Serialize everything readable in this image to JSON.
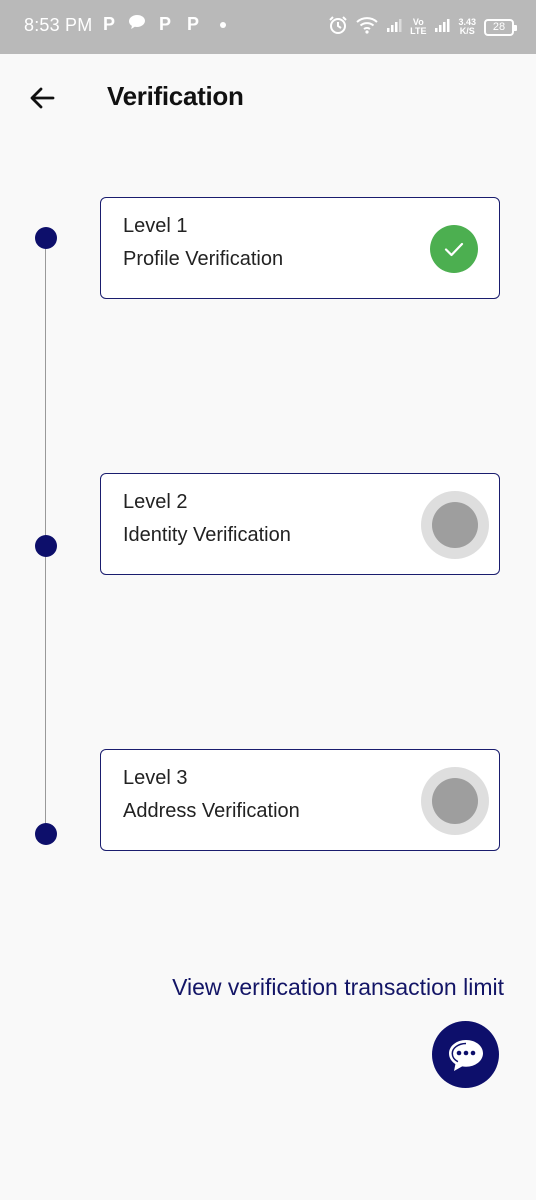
{
  "status_bar": {
    "time": "8:53 PM",
    "notification_icons": [
      "P",
      "P",
      "P"
    ],
    "vol_lte_top": "Vo",
    "vol_lte_bottom": "LTE",
    "speed_value": "3.43",
    "speed_unit": "K/S",
    "battery": "28",
    "icons": [
      "alarm-icon",
      "wifi-icon",
      "signal-icon",
      "chat-bubble-icon",
      "battery-icon"
    ]
  },
  "header": {
    "title": "Verification",
    "back_icon": "arrow-left-icon"
  },
  "levels": [
    {
      "title": "Level 1",
      "subtitle": "Profile Verification",
      "status": "completed"
    },
    {
      "title": "Level 2",
      "subtitle": "Identity Verification",
      "status": "pending"
    },
    {
      "title": "Level 3",
      "subtitle": "Address Verification",
      "status": "pending"
    }
  ],
  "footer": {
    "limit_link": "View verification transaction limit",
    "chat_icon": "chat-support-icon"
  },
  "colors": {
    "primary": "#0d0f6b",
    "success": "#4caf50",
    "pending_outer": "#dedede",
    "pending_inner": "#9e9e9e",
    "status_bar": "#b9b9b9",
    "background": "#f9f9f9"
  }
}
